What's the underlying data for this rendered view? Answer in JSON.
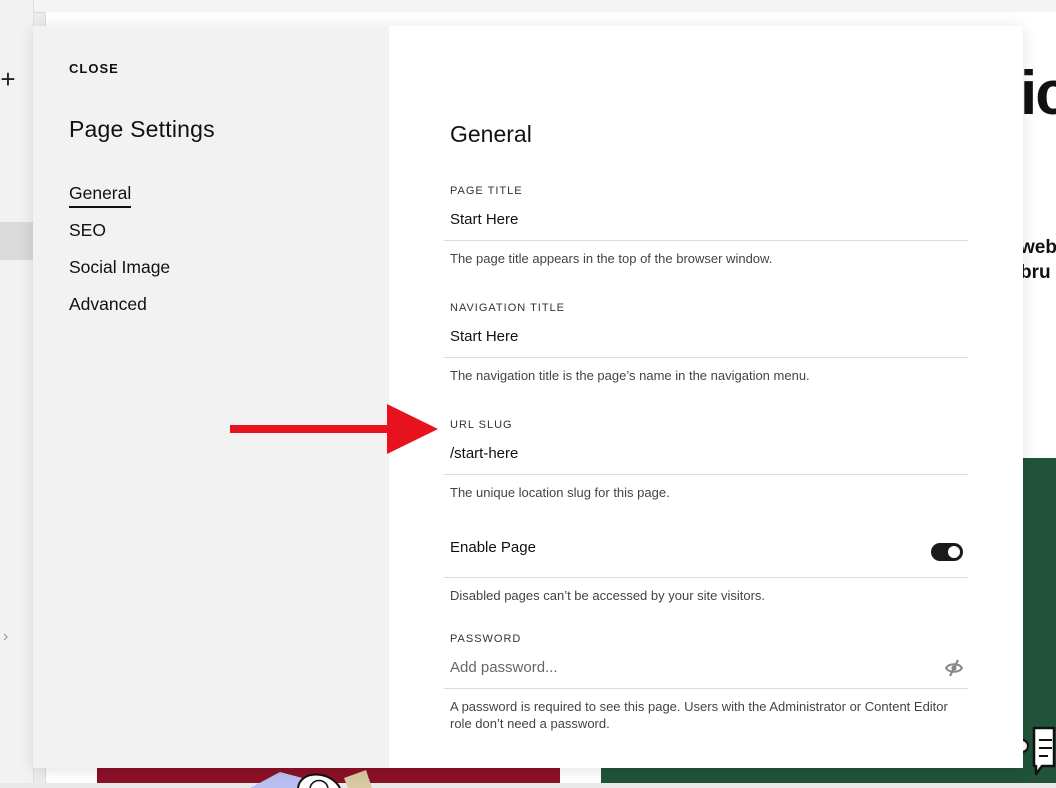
{
  "background": {
    "big_text": "ic",
    "side_text_line1": "web",
    "side_text_line2": "bru",
    "colors": {
      "green_block": "#20533a",
      "red_block": "#8c1027"
    }
  },
  "modal": {
    "close_label": "CLOSE",
    "sidebar": {
      "title": "Page Settings",
      "items": [
        {
          "label": "General",
          "active": true
        },
        {
          "label": "SEO",
          "active": false
        },
        {
          "label": "Social Image",
          "active": false
        },
        {
          "label": "Advanced",
          "active": false
        }
      ]
    },
    "general": {
      "title": "General",
      "page_title": {
        "label": "PAGE TITLE",
        "value": "Start Here",
        "help": "The page title appears in the top of the browser window."
      },
      "navigation_title": {
        "label": "NAVIGATION TITLE",
        "value": "Start Here",
        "help": "The navigation title is the page’s name in the navigation menu."
      },
      "url_slug": {
        "label": "URL SLUG",
        "value": "/start-here",
        "help": "The unique location slug for this page."
      },
      "enable_page": {
        "label": "Enable Page",
        "enabled": true,
        "help": "Disabled pages can’t be accessed by your site visitors."
      },
      "password": {
        "label": "PASSWORD",
        "placeholder": "Add password...",
        "help": "A password is required to see this page. Users with the Administrator or Content Editor role don’t need a password."
      }
    }
  },
  "annotation": {
    "arrow_color": "#e8121f"
  }
}
